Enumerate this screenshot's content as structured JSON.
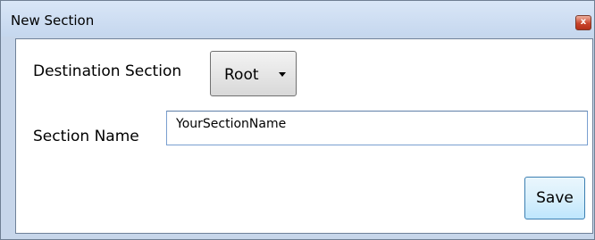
{
  "window": {
    "title": "New Section",
    "close_glyph": "x",
    "close_icon": "close-icon"
  },
  "form": {
    "destination_label": "Destination Section",
    "destination_value": "Root",
    "destination_icon": "chevron-down-icon",
    "name_label": "Section Name",
    "name_value": "YourSectionName",
    "save_label": "Save"
  }
}
